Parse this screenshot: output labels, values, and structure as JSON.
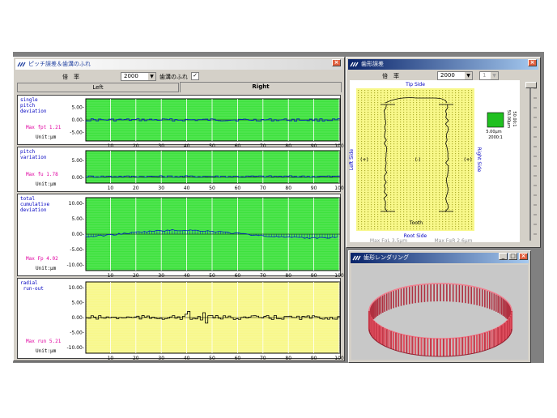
{
  "pitch_window": {
    "title": "ピッチ誤差＆歯溝のふれ",
    "magnification_label": "倍　率",
    "magnification_value": "2000",
    "checkbox_label": "歯溝のふれ",
    "tabs": [
      "Left",
      "Right"
    ],
    "active_tab": "Right",
    "x_ticks": [
      "10",
      "20",
      "30",
      "40",
      "50",
      "60",
      "70",
      "80",
      "90",
      "100"
    ],
    "panels": [
      {
        "label": "single\npitch\ndeviation",
        "max": "Max fpt 1.21",
        "unit": "Unit:μm",
        "y_ticks": [
          "5.00-",
          "0.00-",
          "-5.00-"
        ],
        "bg": "#3ee23e"
      },
      {
        "label": "pitch\nvariation",
        "max": "Max fu 1.78",
        "unit": "Unit:μm",
        "y_ticks": [
          "5.00-",
          "0.00-"
        ],
        "bg": "#3ee23e"
      },
      {
        "label": "total\ncumulative\ndeviation",
        "max": "Max Fp 4.02",
        "unit": "Unit:μm",
        "y_ticks": [
          "10.00-",
          "5.00-",
          "0.00-",
          "-5.00-",
          "-10.00-"
        ],
        "bg": "#3ee23e"
      },
      {
        "label": "radial\n run-out",
        "max": "Max run 5.21",
        "unit": "Unit:μm",
        "y_ticks": [
          "10.00-",
          "5.00-",
          "0.00-",
          "-5.00-",
          "-10.00-"
        ],
        "bg": "#f8f88a"
      }
    ]
  },
  "profile_window": {
    "title": "歯形誤差",
    "magnification_label": "倍　率",
    "magnification_value": "2000",
    "second_combo_value": "1",
    "tip_side": "Tip Side",
    "root_side": "Root Side",
    "left_side": "Left Side",
    "right_side": "Right Side",
    "plus_left": "(+)",
    "minus": "(-)",
    "plus_right": "(+)",
    "tooth": "Tooth",
    "max_left": "Max FαL 3.5μm",
    "max_right": "Max FαR 2.6μm",
    "scale_h": "5.00μm",
    "scale_v": "50.00μm",
    "scale_ratio_v": "50.00:1",
    "scale_ratio_h": "2000:1"
  },
  "render_window": {
    "title": "歯形レンダリング",
    "colors": {
      "ring": "#e05060",
      "bg": "#c8c8c8"
    }
  },
  "colors": {
    "grid_green": "#3ee23e",
    "grid_yellow": "#f8f88a",
    "plot_line": "#0020c0"
  }
}
